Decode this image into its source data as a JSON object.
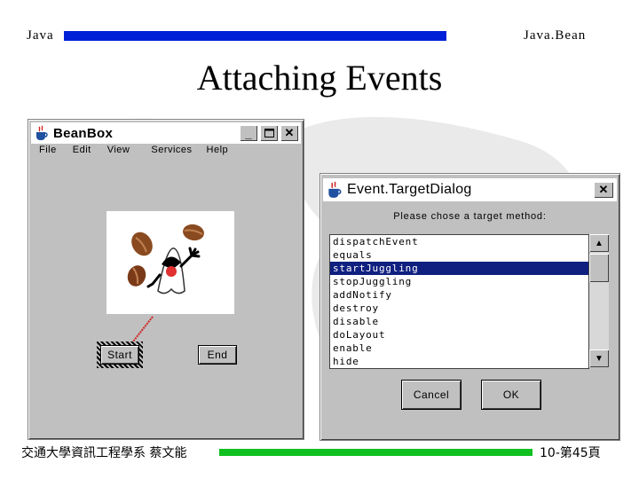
{
  "header": {
    "left": "Java",
    "right": "Java.Bean",
    "title": "Attaching Events"
  },
  "beanbox": {
    "title": "BeanBox",
    "menu": [
      "File",
      "Edit",
      "View",
      "Services",
      "Help"
    ],
    "start_label": "Start",
    "end_label": "End"
  },
  "dialog": {
    "title": "Event.TargetDialog",
    "prompt": "Please chose a target method:",
    "methods": [
      "dispatchEvent",
      "equals",
      "startJuggling",
      "stopJuggling",
      "addNotify",
      "destroy",
      "disable",
      "doLayout",
      "enable",
      "hide"
    ],
    "selected_index": 2,
    "cancel_label": "Cancel",
    "ok_label": "OK"
  },
  "footer": {
    "left": "交通大學資訊工程學系 蔡文能",
    "right": "10-第45頁"
  },
  "colors": {
    "header_bar": "#0020d8",
    "footer_bar": "#10c020",
    "selection": "#102080"
  },
  "icons": {
    "window": "java-cup-icon",
    "minimize": "minimize-icon",
    "maximize": "maximize-icon",
    "close": "close-icon"
  }
}
